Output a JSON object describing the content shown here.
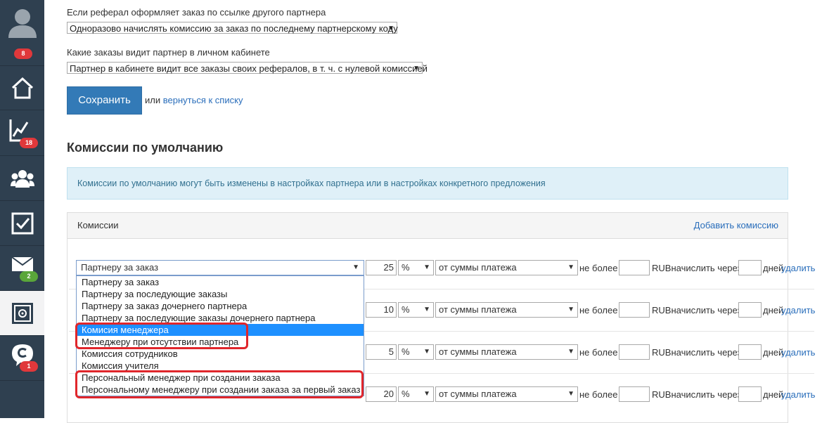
{
  "sidebar": {
    "badges": {
      "profile": "8",
      "stats": "18",
      "mail": "2",
      "chat": "1"
    }
  },
  "settings": {
    "q1_label": "Если реферал оформляет заказ по ссылке другого партнера",
    "q1_value": "Одноразово начислять комиссию за заказ по последнему партнерскому коду",
    "q2_label": "Какие заказы видит партнер в личном кабинете",
    "q2_value": "Партнер в кабинете видит все заказы своих рефералов, в т. ч. с нулевой комиссией",
    "save_label": "Сохранить",
    "or_text": "или",
    "back_link": "вернуться к списку"
  },
  "defaults": {
    "title": "Комиссии по умолчанию",
    "info": "Комиссии по умолчанию могут быть изменены в настройках партнера или в настройках конкретного предложения",
    "panel_title": "Комиссии",
    "add_label": "Добавить комиссию",
    "not_more": "не более",
    "currency_after": "RUBначислить через",
    "days": "дней",
    "delete": "удалить",
    "type_selected": "Партнеру за заказ",
    "type_options": [
      "Партнеру за заказ",
      "Партнеру за последующие заказы",
      "Партнеру за заказ дочернего партнера",
      "Партнеру за последующие заказы дочернего партнера",
      "Комисия менеджера",
      "Менеджеру при отсутствии партнера",
      "Комиссия сотрудников",
      "Комиссия учителя",
      "Персональный менеджер при создании заказа",
      "Персональному менеджеру при создании заказа за первый заказ"
    ],
    "rows": [
      {
        "value": "25",
        "unit": "%",
        "base": "от суммы платежа"
      },
      {
        "value": "10",
        "unit": "%",
        "base": "от суммы платежа"
      },
      {
        "value": "5",
        "unit": "%",
        "base": "от суммы платежа"
      },
      {
        "value": "20",
        "unit": "%",
        "base": "от суммы платежа"
      }
    ]
  },
  "icons": [
    "user-icon",
    "home-icon",
    "chart-icon",
    "group-icon",
    "checkbox-icon",
    "mail-icon",
    "safe-icon",
    "chat-icon"
  ],
  "colors": {
    "sidebar": "#2f4050",
    "primary": "#337ab7",
    "highlight": "#e0262b",
    "selected_option": "#1e90ff"
  }
}
